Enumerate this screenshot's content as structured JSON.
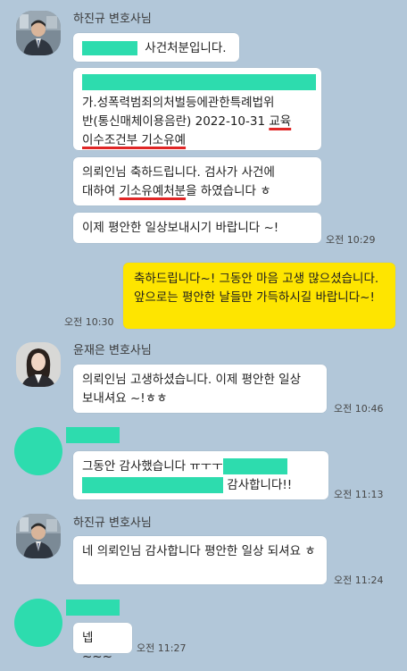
{
  "colors": {
    "background": "#b2c7d9",
    "my_bubble": "#fee500",
    "other_bubble": "#ffffff",
    "redaction": "#2ddcae",
    "underline": "#e02626"
  },
  "messages": {
    "m1": {
      "sender": "하진규 변호사님",
      "b1_text": "사건처분입니다.",
      "b2_line1": "가.성폭력범죄의처벌등에관한특례법위",
      "b2_line2a": "반(통신매체이용음란)  2022-10-31 ",
      "b2_line2b": "교육",
      "b2_line3": "이수조건부 기소유예",
      "b3_line1": "의뢰인님 축하드립니다. 검사가 사건에",
      "b3_line2a": "대하여 ",
      "b3_line2b": "기소유예처분",
      "b3_line2c": "을 하였습니다 ㅎ",
      "b4_text": "이제 평안한 일상보내시기 바랍니다 ~!",
      "time": "오전 10:29"
    },
    "m2": {
      "text": "축하드립니다~! 그동안 마음 고생 많으셨습니다. 앞으로는 평안한 날들만 가득하시길 바랍니다~!",
      "time": "오전 10:30"
    },
    "m3": {
      "sender": "윤재은 변호사님",
      "text": "의뢰인님 고생하셨습니다. 이제 평안한 일상 보내셔요 ~!ㅎㅎ",
      "time": "오전 10:46"
    },
    "m4": {
      "line1": "그동안 감사했습니다 ㅠㅜㅜ",
      "line2": "감사합니다!!",
      "time": "오전 11:13"
    },
    "m5": {
      "sender": "하진규 변호사님",
      "text": "네 의뢰인님 감사합니다 평안한 일상 되셔요 ㅎ",
      "time": "오전 11:24"
    },
    "m6": {
      "text": "넵~~~",
      "time": "오전 11:27"
    }
  }
}
